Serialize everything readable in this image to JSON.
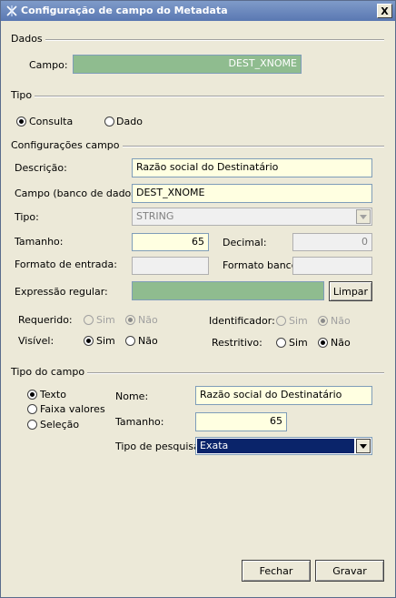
{
  "window": {
    "title": "Configuração de campo do Metadata",
    "close_glyph": "X"
  },
  "dados": {
    "section_label": "Dados",
    "campo_label": "Campo:",
    "campo_value": "DEST_XNOME"
  },
  "tipo": {
    "section_label": "Tipo",
    "options": [
      {
        "label": "Consulta",
        "checked": true
      },
      {
        "label": "Dado",
        "checked": false
      }
    ]
  },
  "config": {
    "section_label": "Configurações campo",
    "descricao_label": "Descrição:",
    "descricao_value": "Razão social do Destinatário",
    "campo_bd_label": "Campo (banco de dados):",
    "campo_bd_value": "DEST_XNOME",
    "tipo_label": "Tipo:",
    "tipo_value": "STRING",
    "tamanho_label": "Tamanho:",
    "tamanho_value": "65",
    "decimal_label": "Decimal:",
    "decimal_value": "0",
    "formato_entrada_label": "Formato de entrada:",
    "formato_entrada_value": "",
    "formato_banco_label": "Formato banco:",
    "formato_banco_value": "",
    "expressao_label": "Expressão regular:",
    "expressao_value": "",
    "limpar_label": "Limpar",
    "requerido_label": "Requerido:",
    "identificador_label": "Identificador:",
    "visivel_label": "Visível:",
    "restritivo_label": "Restritivo:",
    "sim": "Sim",
    "nao": "Não"
  },
  "tipo_campo": {
    "section_label": "Tipo do campo",
    "options": [
      {
        "label": "Texto",
        "checked": true
      },
      {
        "label": "Faixa valores",
        "checked": false
      },
      {
        "label": "Seleção",
        "checked": false
      }
    ],
    "nome_label": "Nome:",
    "nome_value": "Razão social do Destinatário",
    "tamanho_label": "Tamanho:",
    "tamanho_value": "65",
    "pesquisa_label": "Tipo de pesquisa:",
    "pesquisa_value": "Exata"
  },
  "footer": {
    "fechar_label": "Fechar",
    "gravar_label": "Gravar"
  },
  "colors": {
    "accent": "#0a246a",
    "title_bar": "#6a89c0",
    "input_yellow": "#ffffe1",
    "input_green": "#8fbc8f"
  }
}
